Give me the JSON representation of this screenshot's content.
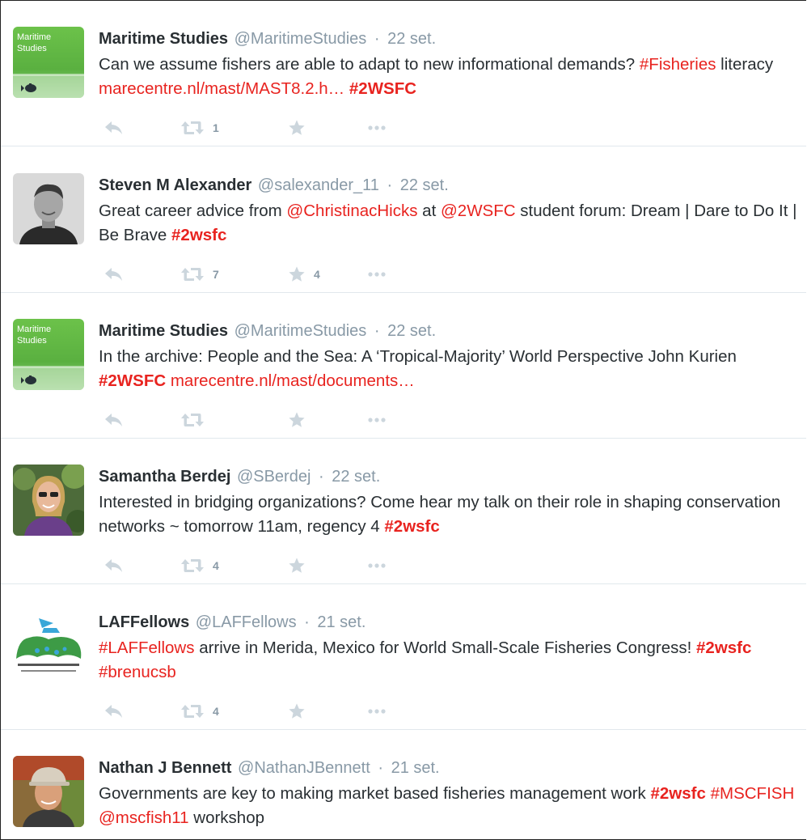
{
  "tweets": [
    {
      "name": "Maritime Studies",
      "handle": "@MaritimeStudies",
      "time": "22 set.",
      "avatar": "maritime",
      "avatar_text": [
        "Maritime",
        "Studies"
      ],
      "text_parts": [
        {
          "t": "Can we assume fishers are able to adapt to new informational demands? "
        },
        {
          "t": "#Fisheries",
          "tag": true
        },
        {
          "t": " literacy "
        },
        {
          "t": "marecentre.nl/mast/MAST8.2.h…",
          "tag": true
        },
        {
          "t": " "
        },
        {
          "t": "#2WSFC",
          "tag": true,
          "bold": true
        }
      ],
      "retweets": "1",
      "favorites": ""
    },
    {
      "name": "Steven M Alexander",
      "handle": "@salexander_11",
      "time": "22 set.",
      "avatar": "steven",
      "text_parts": [
        {
          "t": "Great career advice from "
        },
        {
          "t": "@ChristinacHicks",
          "tag": true
        },
        {
          "t": " at "
        },
        {
          "t": "@2WSFC",
          "tag": true
        },
        {
          "t": " student forum: Dream | Dare to Do It | Be Brave "
        },
        {
          "t": "#2wsfc",
          "tag": true,
          "bold": true
        }
      ],
      "retweets": "7",
      "favorites": "4"
    },
    {
      "name": "Maritime Studies",
      "handle": "@MaritimeStudies",
      "time": "22 set.",
      "avatar": "maritime",
      "avatar_text": [
        "Maritime",
        "Studies"
      ],
      "text_parts": [
        {
          "t": "In the archive: People and the Sea: A ‘Tropical-Majority’ World Perspective John Kurien "
        },
        {
          "t": "#2WSFC",
          "tag": true,
          "bold": true
        },
        {
          "t": " "
        },
        {
          "t": "marecentre.nl/mast/documents…",
          "tag": true
        }
      ],
      "retweets": "",
      "favorites": ""
    },
    {
      "name": "Samantha Berdej",
      "handle": "@SBerdej",
      "time": "22 set.",
      "avatar": "samantha",
      "text_parts": [
        {
          "t": "Interested in bridging organizations? Come hear my talk on their role in shaping conservation networks ~ tomorrow 11am, regency 4 "
        },
        {
          "t": "#2wsfc",
          "tag": true,
          "bold": true
        }
      ],
      "retweets": "4",
      "favorites": ""
    },
    {
      "name": "LAFFellows",
      "handle": "@LAFFellows",
      "time": "21 set.",
      "avatar": "laf",
      "text_parts": [
        {
          "t": "#LAFFellows",
          "tag": true
        },
        {
          "t": " arrive in Merida, Mexico for World Small-Scale Fisheries Congress! "
        },
        {
          "t": "#2wsfc",
          "tag": true,
          "bold": true
        },
        {
          "t": " "
        },
        {
          "t": "#brenucsb",
          "tag": true
        }
      ],
      "retweets": "4",
      "favorites": ""
    },
    {
      "name": "Nathan J Bennett",
      "handle": "@NathanJBennett",
      "time": "21 set.",
      "avatar": "nathan",
      "text_parts": [
        {
          "t": "Governments are key to making market based fisheries management work "
        },
        {
          "t": "#2wsfc",
          "tag": true,
          "bold": true
        },
        {
          "t": " "
        },
        {
          "t": "#MSCFISH",
          "tag": true
        },
        {
          "t": " "
        },
        {
          "t": "@mscfish11",
          "tag": true
        },
        {
          "t": " workshop"
        }
      ],
      "retweets": "",
      "favorites": ""
    }
  ],
  "separator": "·",
  "icons": {
    "reply": "reply-icon",
    "retweet": "retweet-icon",
    "favorite": "star-icon",
    "more": "more-icon"
  },
  "colors": {
    "tag": "#e8231f",
    "meta": "#8899a6",
    "icon": "#ccd6dd",
    "name": "#292f33"
  }
}
